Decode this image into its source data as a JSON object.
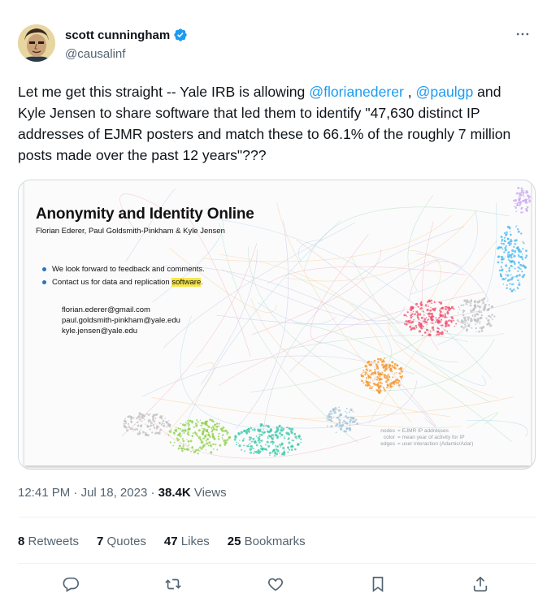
{
  "author": {
    "display_name": "scott cunningham",
    "handle": "@causalinf"
  },
  "tweet": {
    "text_1": "Let me get this straight -- Yale IRB is allowing ",
    "mention_1": "@florianederer",
    "text_2": " , ",
    "mention_2": "@paulgp",
    "text_3": " and Kyle Jensen to share software that led them to identify \"47,630 distinct IP addresses of EJMR posters and match these to 66.1% of the roughly 7 million posts made over the past 12 years\"???"
  },
  "slide": {
    "title": "Anonymity and Identity Online",
    "authors": "Florian Ederer, Paul Goldsmith-Pinkham & Kyle Jensen",
    "bullet_1": "We look forward to feedback and comments.",
    "bullet_2_pre": "Contact us for data and replication ",
    "bullet_2_hl": "software",
    "bullet_2_post": ".",
    "email_1": "florian.ederer@gmail.com",
    "email_2": "paul.goldsmith-pinkham@yale.edu",
    "email_3": "kyle.jensen@yale.edu",
    "legend": [
      {
        "key": "nodes",
        "value": "= EJMR IP addresses"
      },
      {
        "key": "color",
        "value": "= mean year of activity for IP"
      },
      {
        "key": "edges",
        "value": "= user interaction (Adamic/Adar)"
      }
    ]
  },
  "meta": {
    "time": "12:41 PM",
    "sep_1": " · ",
    "date": "Jul 18, 2023",
    "sep_2": " · ",
    "views_count": "38.4K",
    "views_label": " Views"
  },
  "stats": {
    "retweets_count": "8",
    "retweets_label": " Retweets",
    "quotes_count": "7",
    "quotes_label": " Quotes",
    "likes_count": "47",
    "likes_label": " Likes",
    "bookmarks_count": "25",
    "bookmarks_label": " Bookmarks"
  },
  "icons": {
    "more": "more-horizontal-icon",
    "reply": "reply-icon",
    "retweet": "retweet-icon",
    "like": "like-icon",
    "bookmark": "bookmark-icon",
    "share": "share-icon",
    "verified": "verified-badge-icon"
  },
  "colors": {
    "link": "#1d9bf0",
    "secondary_text": "#536471",
    "primary_text": "#0f1419"
  }
}
